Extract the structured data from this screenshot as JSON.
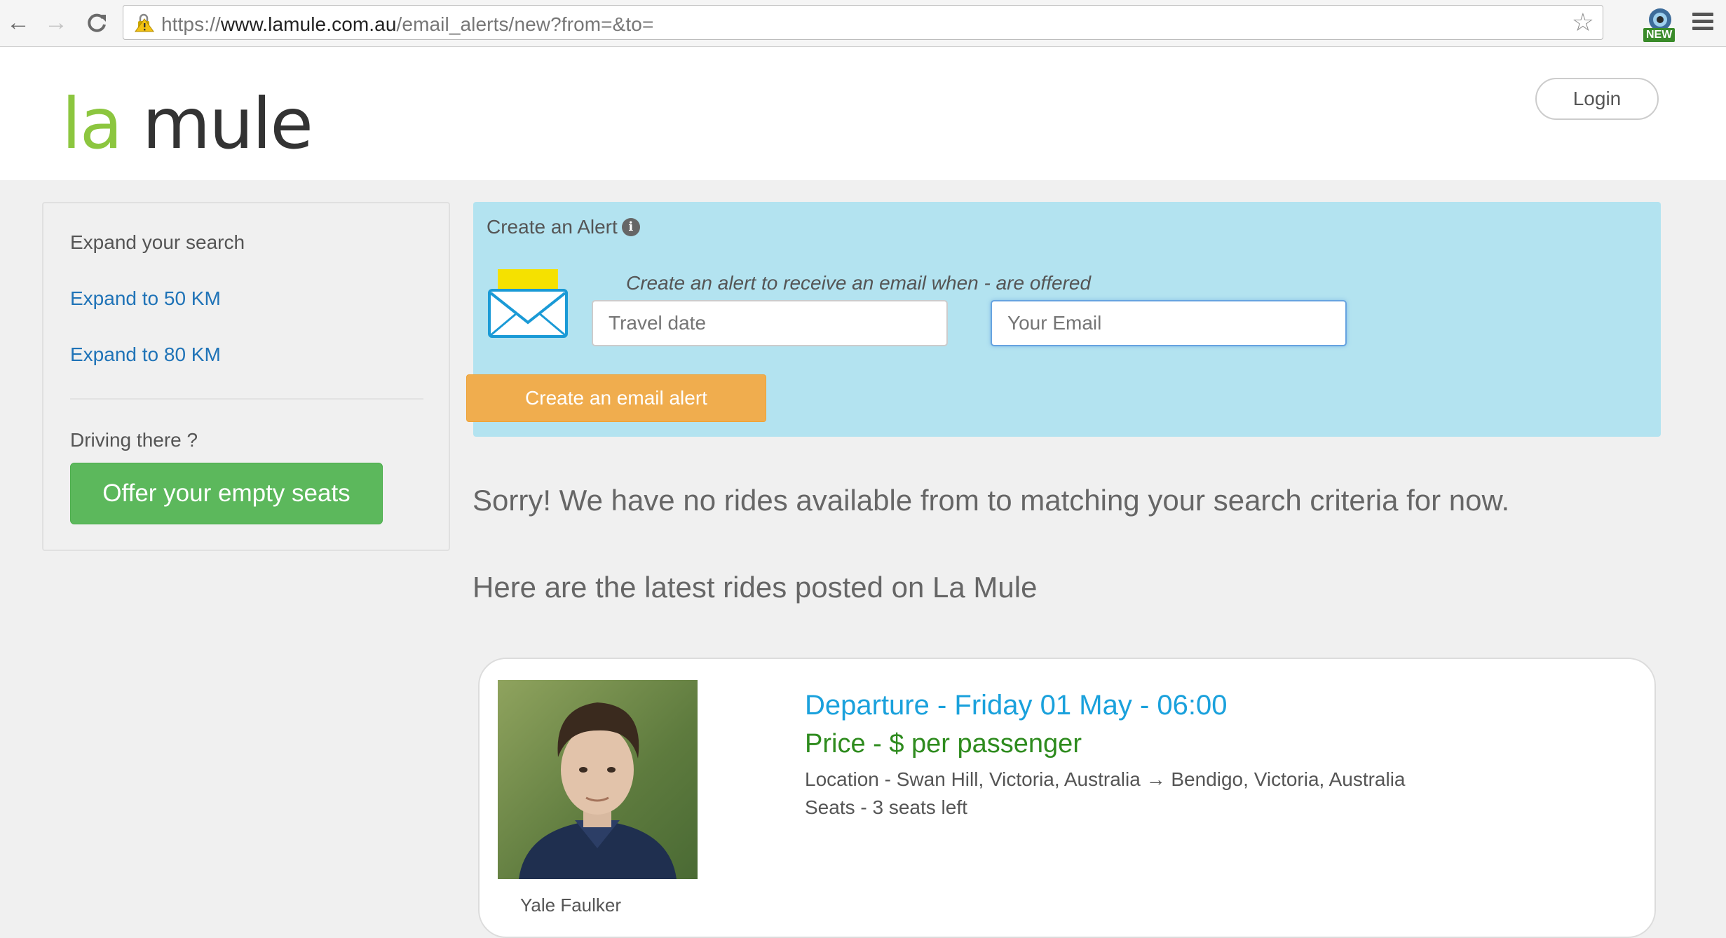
{
  "browser": {
    "url_prefix": "https://",
    "url_host": "www.lamule.com.au",
    "url_path": "/email_alerts/new?from=&to=",
    "extension_badge": "NEW"
  },
  "header": {
    "logo_la": "la",
    "logo_mule": "mule",
    "login_label": "Login"
  },
  "sidebar": {
    "heading": "Expand your search",
    "expand_50": "Expand to 50 KM",
    "expand_80": "Expand to 80 KM",
    "driving_label": "Driving there ?",
    "offer_button": "Offer your empty seats"
  },
  "alert": {
    "title": "Create an Alert",
    "description": "Create an alert to receive an email when - are offered",
    "date_placeholder": "Travel date",
    "email_placeholder": "Your Email",
    "button_label": "Create an email alert"
  },
  "messages": {
    "sorry": "Sorry! We have no rides available from to matching your search criteria for now.",
    "latest": "Here are the latest rides posted on La Mule"
  },
  "ride": {
    "departure": "Departure - Friday 01 May - 06:00",
    "price": "Price - $ per passenger",
    "location": "Location - Swan Hill, Victoria, Australia → Bendigo, Victoria, Australia",
    "seats": "Seats - 3 seats left",
    "driver_name": "Yale Faulker"
  },
  "colors": {
    "logo_green": "#8cc63f",
    "alert_bg": "#b3e3f0",
    "offer_green": "#5cb85c",
    "alert_orange": "#f0ad4e",
    "departure_blue": "#1aa1dc",
    "price_green": "#2e8b1e"
  }
}
